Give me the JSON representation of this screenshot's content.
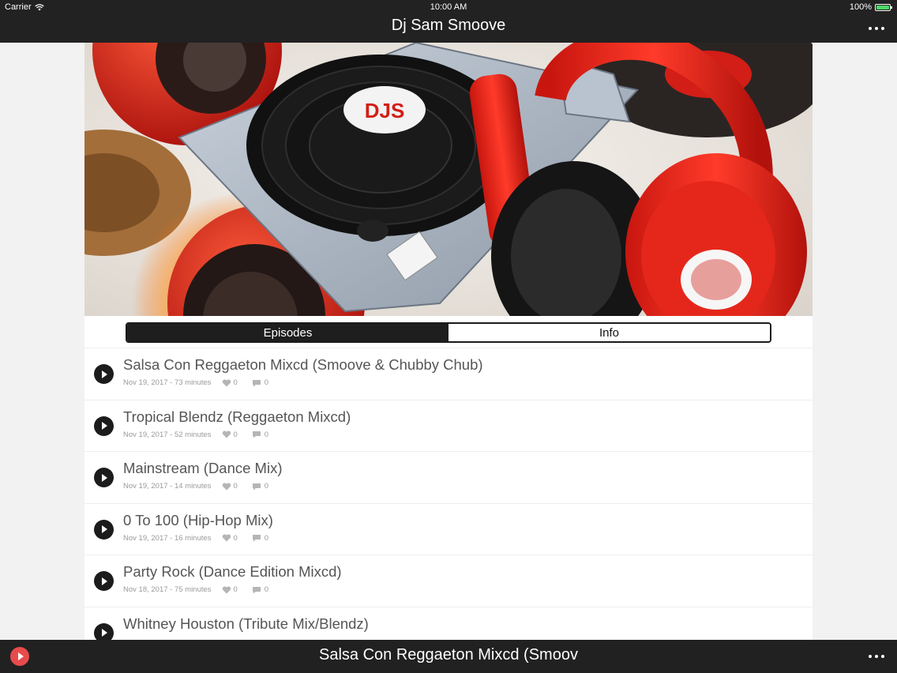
{
  "status_bar": {
    "carrier": "Carrier",
    "time": "10:00 AM",
    "battery": "100%"
  },
  "nav": {
    "title": "Dj Sam Smoove"
  },
  "tabs": [
    {
      "label": "Episodes",
      "active": true
    },
    {
      "label": "Info",
      "active": false
    }
  ],
  "episodes": [
    {
      "title": "Salsa Con Reggaeton Mixcd (Smoove & Chubby Chub)",
      "meta": "Nov 19, 2017 - 73 minutes",
      "likes": "0",
      "comments": "0"
    },
    {
      "title": "Tropical Blendz (Reggaeton Mixcd)",
      "meta": "Nov 19, 2017 - 52 minutes",
      "likes": "0",
      "comments": "0"
    },
    {
      "title": "Mainstream (Dance Mix)",
      "meta": "Nov 19, 2017 - 14 minutes",
      "likes": "0",
      "comments": "0"
    },
    {
      "title": "0 To 100 (Hip-Hop Mix)",
      "meta": "Nov 19, 2017 - 16 minutes",
      "likes": "0",
      "comments": "0"
    },
    {
      "title": "Party Rock (Dance Edition Mixcd)",
      "meta": "Nov 18, 2017 - 75 minutes",
      "likes": "0",
      "comments": "0"
    },
    {
      "title": "Whitney Houston (Tribute Mix/Blendz)",
      "meta": "",
      "likes": "",
      "comments": ""
    }
  ],
  "player": {
    "now_playing": "Salsa Con Reggaeton Mixcd (Smoov"
  },
  "hero": {
    "record_label_text": "DJS"
  },
  "colors": {
    "bar_background": "#222222",
    "accent_red": "#e84b4b",
    "battery_green": "#4cd964"
  },
  "icons": {
    "wifi": "wifi-icon",
    "battery": "battery-icon",
    "more": "more-icon",
    "play": "play-icon",
    "heart": "heart-icon",
    "comment": "comment-icon"
  }
}
